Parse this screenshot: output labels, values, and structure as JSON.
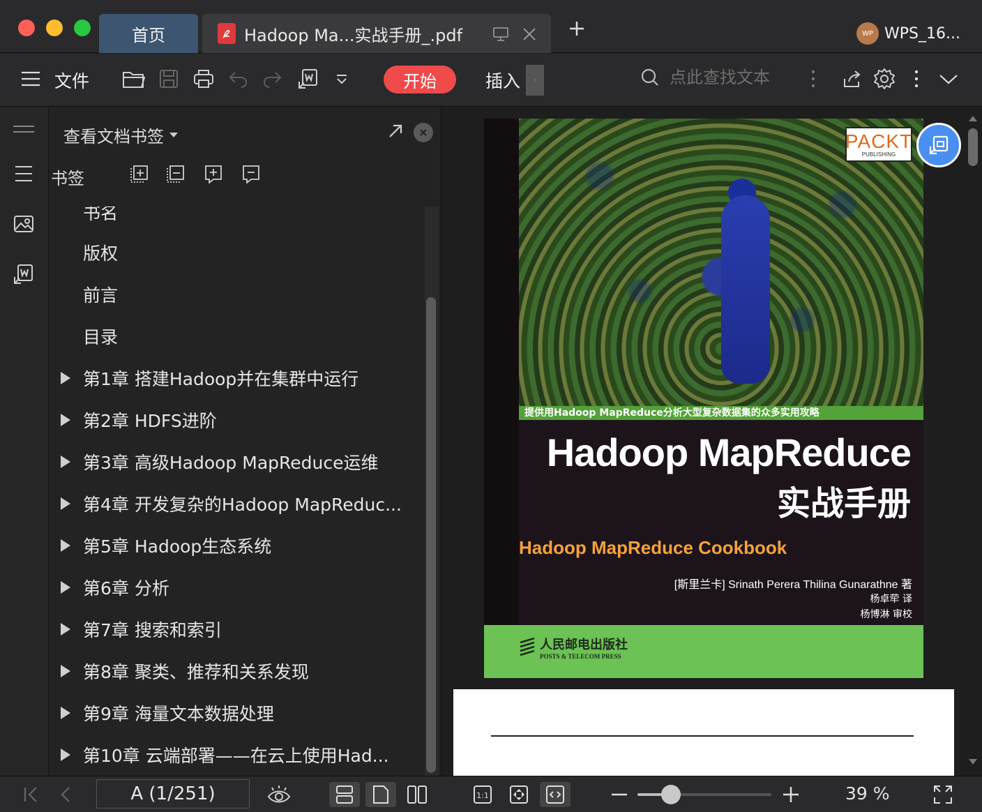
{
  "window": {
    "tabs": [
      {
        "label": "首页"
      },
      {
        "label": "Hadoop Ma...实战手册_.pdf"
      }
    ],
    "account": {
      "avatar_text": "WP",
      "name": "WPS_16..."
    }
  },
  "toolbar": {
    "file_label": "文件",
    "start_label": "开始",
    "insert_label": "插入",
    "search_placeholder": "点此查找文本"
  },
  "bookmarks": {
    "panel_title": "查看文档书签",
    "section_label": "书签",
    "items": [
      {
        "label": "书名",
        "expandable": false
      },
      {
        "label": "版权",
        "expandable": false
      },
      {
        "label": "前言",
        "expandable": false
      },
      {
        "label": "目录",
        "expandable": false
      },
      {
        "label": "第1章 搭建Hadoop并在集群中运行",
        "expandable": true
      },
      {
        "label": "第2章 HDFS进阶",
        "expandable": true
      },
      {
        "label": "第3章 高级Hadoop MapReduce运维",
        "expandable": true
      },
      {
        "label": "第4章 开发复杂的Hadoop MapReduc...",
        "expandable": true
      },
      {
        "label": "第5章 Hadoop生态系统",
        "expandable": true
      },
      {
        "label": "第6章 分析",
        "expandable": true
      },
      {
        "label": "第7章 搜索和索引",
        "expandable": true
      },
      {
        "label": "第8章 聚类、推荐和关系发现",
        "expandable": true
      },
      {
        "label": "第9章 海量文本数据处理",
        "expandable": true
      },
      {
        "label": "第10章 云端部署——在云上使用Had...",
        "expandable": true
      }
    ]
  },
  "cover": {
    "packt": "PACKT",
    "packt_sub": "PUBLISHING",
    "band_text": "提供用Hadoop MapReduce分析大型复杂数据集的众多实用攻略",
    "title_en": "Hadoop MapReduce",
    "title_cn": "实战手册",
    "subtitle": "Hadoop MapReduce Cookbook",
    "authors": "[斯里兰卡] Srinath Perera   Thilina Gunarathne   著",
    "translator": "杨卓荦   译",
    "reviewer": "杨博淋   审校",
    "publisher_cn": "人民邮电出版社",
    "publisher_en": "POSTS & TELECOM PRESS"
  },
  "statusbar": {
    "page_indicator": "A (1/251)",
    "zoom_label": "39 %",
    "zoom_percent": 39
  },
  "colors": {
    "accent_red": "#ef4b4b",
    "home_tab": "#3d5570",
    "float_button": "#4a8ff0"
  }
}
